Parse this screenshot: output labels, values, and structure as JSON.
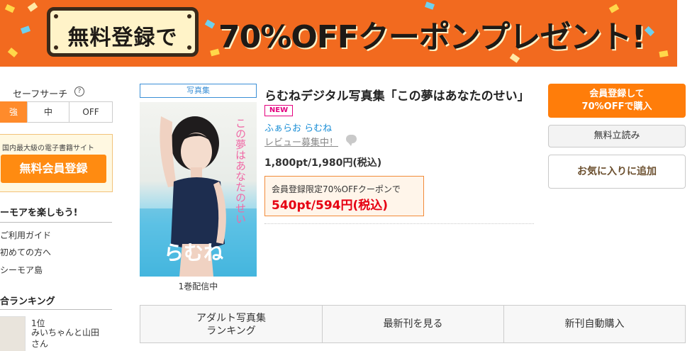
{
  "banner": {
    "pill_text": "無料登録で",
    "headline": "70%OFFクーポンプレゼント!",
    "colors": {
      "background": "#f26a1f",
      "pill": "#fff3c8",
      "ink": "#1e1a16"
    }
  },
  "sidebar": {
    "safe_search": {
      "title": "セーフサーチ",
      "help_icon": "question-circle-icon",
      "options": [
        "強",
        "中",
        "OFF"
      ],
      "selected": "強"
    },
    "promo": {
      "subtitle": "国内最大級の電子書籍サイト",
      "button_label": "無料会員登録"
    },
    "enjoy_heading": "ーモアを楽しもう!",
    "links": [
      "ご利用ガイド",
      "初めての方へ",
      "シーモア島"
    ],
    "ranking": {
      "heading": "合ランキング",
      "first_rank": "1位",
      "first_title": "みいちゃんと山田さん"
    }
  },
  "product": {
    "category": "写真集",
    "title": "らむねデジタル写真集「この夢はあなたのせい」",
    "badge": "NEW",
    "author": "ふぁらお らむね",
    "review_link": "レビュー募集中！",
    "price": "1,800pt/1,980円(税込)",
    "coupon": {
      "label": "会員登録限定70%OFFクーポンで",
      "discount_price": "540pt/594円(税込)"
    },
    "cover": {
      "title_text": "この夢はあなたのせい",
      "name_text": "らむね"
    },
    "volume_status": "1巻配信中"
  },
  "actions": {
    "register_line1": "会員登録して",
    "register_line2": "70%OFFで購入",
    "trial": "無料立読み",
    "favorite": "お気に入りに追加"
  },
  "tabs": {
    "ranking_line1": "アダルト写真集",
    "ranking_line2": "ランキング",
    "latest": "最新刊を見る",
    "auto_buy": "新刊自動購入"
  },
  "colors": {
    "accent_orange": "#ff7d0a",
    "link_blue": "#1a8ed6",
    "sale_red": "#e60012",
    "new_pink": "#e4007f"
  }
}
